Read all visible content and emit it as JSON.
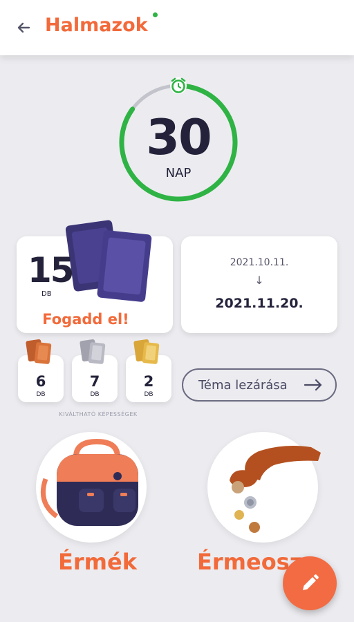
{
  "header": {
    "title": "Halmazok",
    "back_icon": "arrow-left-icon",
    "status_dot_color": "#2fb344"
  },
  "timer": {
    "value": "30",
    "unit": "NAP",
    "progress": 0.85,
    "icon": "alarm-clock-icon",
    "ring_color": "#2fb344"
  },
  "cards_panel": {
    "count": "15",
    "unit": "DB",
    "accept_label": "Fogadd el!",
    "icon": "card-stack-icon"
  },
  "dates_panel": {
    "from": "2021.10.11.",
    "arrow": "↓",
    "to": "2021.11.20."
  },
  "badges": [
    {
      "count": "6",
      "unit": "DB",
      "color": "#d9733a",
      "icon": "bronze-cards-icon"
    },
    {
      "count": "7",
      "unit": "DB",
      "color": "#b9b9c4",
      "icon": "silver-cards-icon"
    },
    {
      "count": "2",
      "unit": "DB",
      "color": "#e6b94a",
      "icon": "gold-cards-icon"
    }
  ],
  "badges_caption": "KIVÁLTHATÓ KÉPESSÉGEK",
  "close_button": {
    "label": "Téma lezárása",
    "icon": "arrow-right-icon"
  },
  "tiles": [
    {
      "label": "Érmék",
      "icon": "backpack-icon"
    },
    {
      "label": "Érmeosz",
      "icon": "coin-drop-icon"
    }
  ],
  "fab": {
    "icon": "pencil-icon",
    "color": "#f36b42"
  },
  "colors": {
    "accent": "#f26a3a",
    "ink": "#23223a",
    "background": "#ececf0"
  }
}
